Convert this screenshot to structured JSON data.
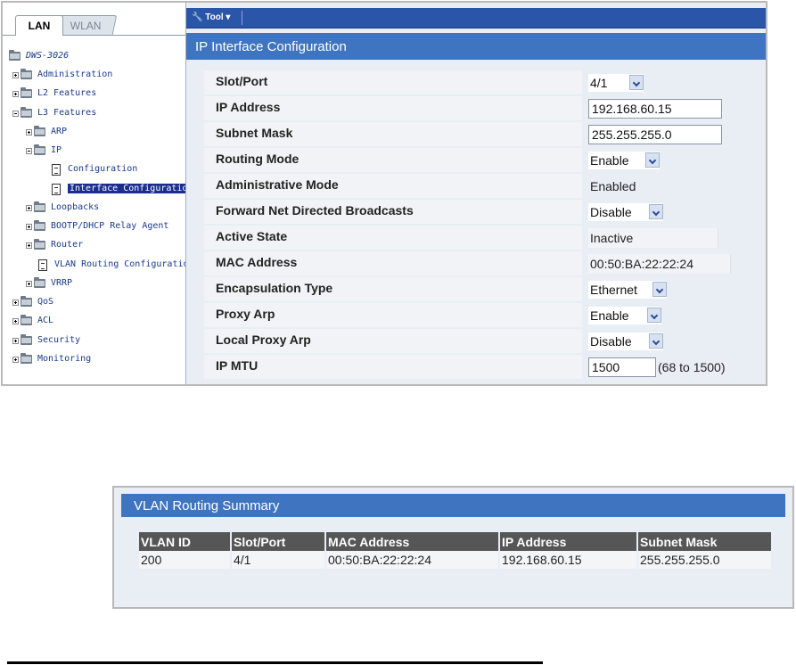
{
  "tabs": [
    "LAN",
    "WLAN"
  ],
  "tree": [
    {
      "label": "DWS-3026",
      "kind": "root"
    },
    {
      "label": "Administration",
      "kind": "folder"
    },
    {
      "label": "L2 Features",
      "kind": "folder"
    },
    {
      "label": "L3 Features",
      "kind": "folder-open"
    },
    {
      "label": "ARP",
      "kind": "folder"
    },
    {
      "label": "IP",
      "kind": "folder-open"
    },
    {
      "label": "Configuration",
      "kind": "doc"
    },
    {
      "label": "Interface Configuration",
      "kind": "doc-selected"
    },
    {
      "label": "Loopbacks",
      "kind": "folder"
    },
    {
      "label": "BOOTP/DHCP Relay Agent",
      "kind": "folder"
    },
    {
      "label": "Router",
      "kind": "folder"
    },
    {
      "label": "VLAN Routing Configuration",
      "kind": "doc"
    },
    {
      "label": "VRRP",
      "kind": "folder"
    },
    {
      "label": "QoS",
      "kind": "folder"
    },
    {
      "label": "ACL",
      "kind": "folder"
    },
    {
      "label": "Security",
      "kind": "folder"
    },
    {
      "label": "Monitoring",
      "kind": "folder"
    }
  ],
  "toolbar": {
    "tool_label": "Tool"
  },
  "panel": {
    "title": "IP Interface Configuration"
  },
  "form": {
    "slot_port": {
      "label": "Slot/Port",
      "value": "4/1"
    },
    "ip_address": {
      "label": "IP Address",
      "value": "192.168.60.15"
    },
    "subnet_mask": {
      "label": "Subnet Mask",
      "value": "255.255.255.0"
    },
    "routing_mode": {
      "label": "Routing Mode",
      "value": "Enable"
    },
    "admin_mode": {
      "label": "Administrative Mode",
      "value": "Enabled"
    },
    "fwd_broadcasts": {
      "label": "Forward Net Directed Broadcasts",
      "value": "Disable"
    },
    "active_state": {
      "label": "Active State",
      "value": "Inactive"
    },
    "mac_address": {
      "label": "MAC Address",
      "value": "00:50:BA:22:22:24"
    },
    "encapsulation": {
      "label": "Encapsulation Type",
      "value": "Ethernet"
    },
    "proxy_arp": {
      "label": "Proxy Arp",
      "value": "Enable"
    },
    "local_proxy_arp": {
      "label": "Local Proxy Arp",
      "value": "Disable"
    },
    "ip_mtu": {
      "label": "IP MTU",
      "value": "1500",
      "hint": "(68 to 1500)"
    }
  },
  "summary": {
    "title": "VLAN Routing Summary",
    "columns": [
      "VLAN ID",
      "Slot/Port",
      "MAC Address",
      "IP Address",
      "Subnet Mask"
    ],
    "rows": [
      [
        "200",
        "4/1",
        "00:50:BA:22:22:24",
        "192.168.60.15",
        "255.255.255.0"
      ]
    ]
  }
}
